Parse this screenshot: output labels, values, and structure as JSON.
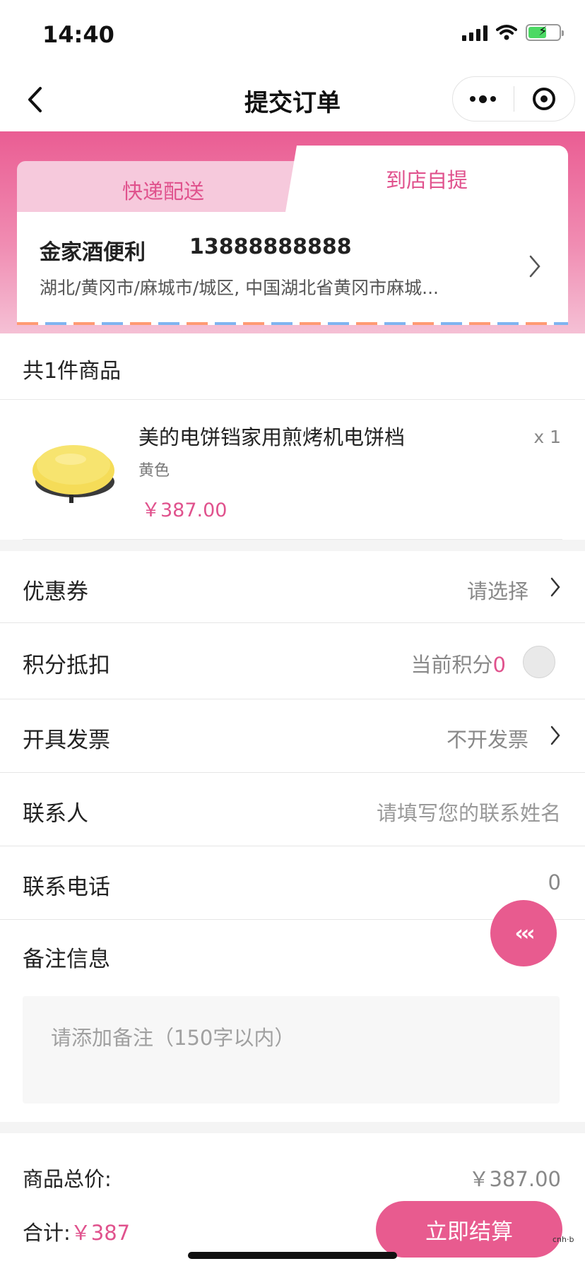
{
  "status_bar": {
    "time": "14:40",
    "icons": [
      "signal-icon",
      "wifi-icon",
      "battery-charging-icon"
    ]
  },
  "nav": {
    "title": "提交订单",
    "back_icon": "chevron-left-icon",
    "menu_icon": "more-dots-icon",
    "close_icon": "target-circle-icon"
  },
  "delivery": {
    "tabs": [
      {
        "label": "快递配送",
        "active": false
      },
      {
        "label": "到店自提",
        "active": true
      }
    ],
    "store_name": "金家酒便利",
    "store_phone": "13888888888",
    "store_address": "湖北/黄冈市/麻城市/城区, 中国湖北省黄冈市麻城..."
  },
  "goods": {
    "count_text": "共1件商品",
    "items": [
      {
        "name": "美的电饼铛家用煎烤机电饼档",
        "spec": "黄色",
        "price": "￥387.00",
        "qty": "x 1"
      }
    ]
  },
  "rows": {
    "coupon": {
      "label": "优惠券",
      "value": "请选择"
    },
    "points": {
      "label": "积分抵扣",
      "value_prefix": "当前积分",
      "points": "0",
      "enabled": false
    },
    "invoice": {
      "label": "开具发票",
      "value": "不开发票"
    },
    "contact": {
      "label": "联系人",
      "placeholder": "请填写您的联系姓名"
    },
    "phone": {
      "label": "联系电话",
      "value": "0"
    },
    "remark": {
      "label": "备注信息",
      "placeholder": "请添加备注（150字以内）"
    }
  },
  "fab": {
    "label": "‹‹‹"
  },
  "summary": {
    "goods_total_label": "商品总价:",
    "goods_total_value": "￥387.00",
    "total_label": "合计:",
    "total_value": "￥387",
    "pay_button": "立即结算"
  },
  "colors": {
    "accent": "#e85b8f",
    "accent_text": "#e0528d",
    "tab_inactive_bg": "#f6c9dc"
  }
}
